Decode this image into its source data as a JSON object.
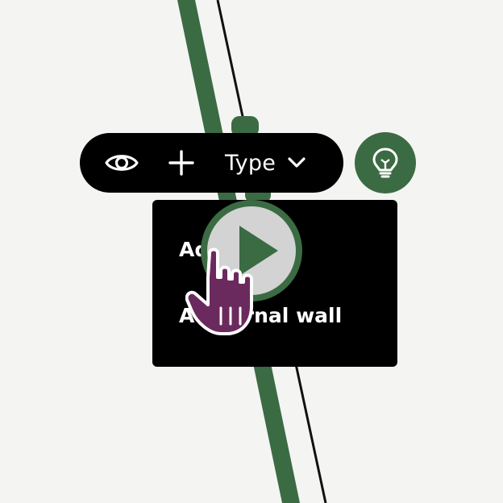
{
  "colors": {
    "background": "#f4f4f2",
    "wall_green": "#3b6b43",
    "wall_line": "#111111",
    "toolbar_bg": "#000000",
    "menu_bg": "#000000",
    "hint_bg": "#3b6b43",
    "play_ring": "#3b6b43",
    "play_fill": "#d3d3d3",
    "hand_purple": "#6b2a5e"
  },
  "toolbar": {
    "eye_icon": "eye-icon",
    "plus_icon": "plus-icon",
    "type_label": "Type",
    "type_chevron_icon": "chevron-down-icon"
  },
  "hint_button": {
    "icon": "lightbulb-icon"
  },
  "type_menu": {
    "items": [
      {
        "label": "Add d    ce"
      },
      {
        "label": "Add     ernal wall"
      }
    ]
  },
  "overlay": {
    "play_icon": "play-icon",
    "hand_icon": "hand-cursor-icon"
  }
}
